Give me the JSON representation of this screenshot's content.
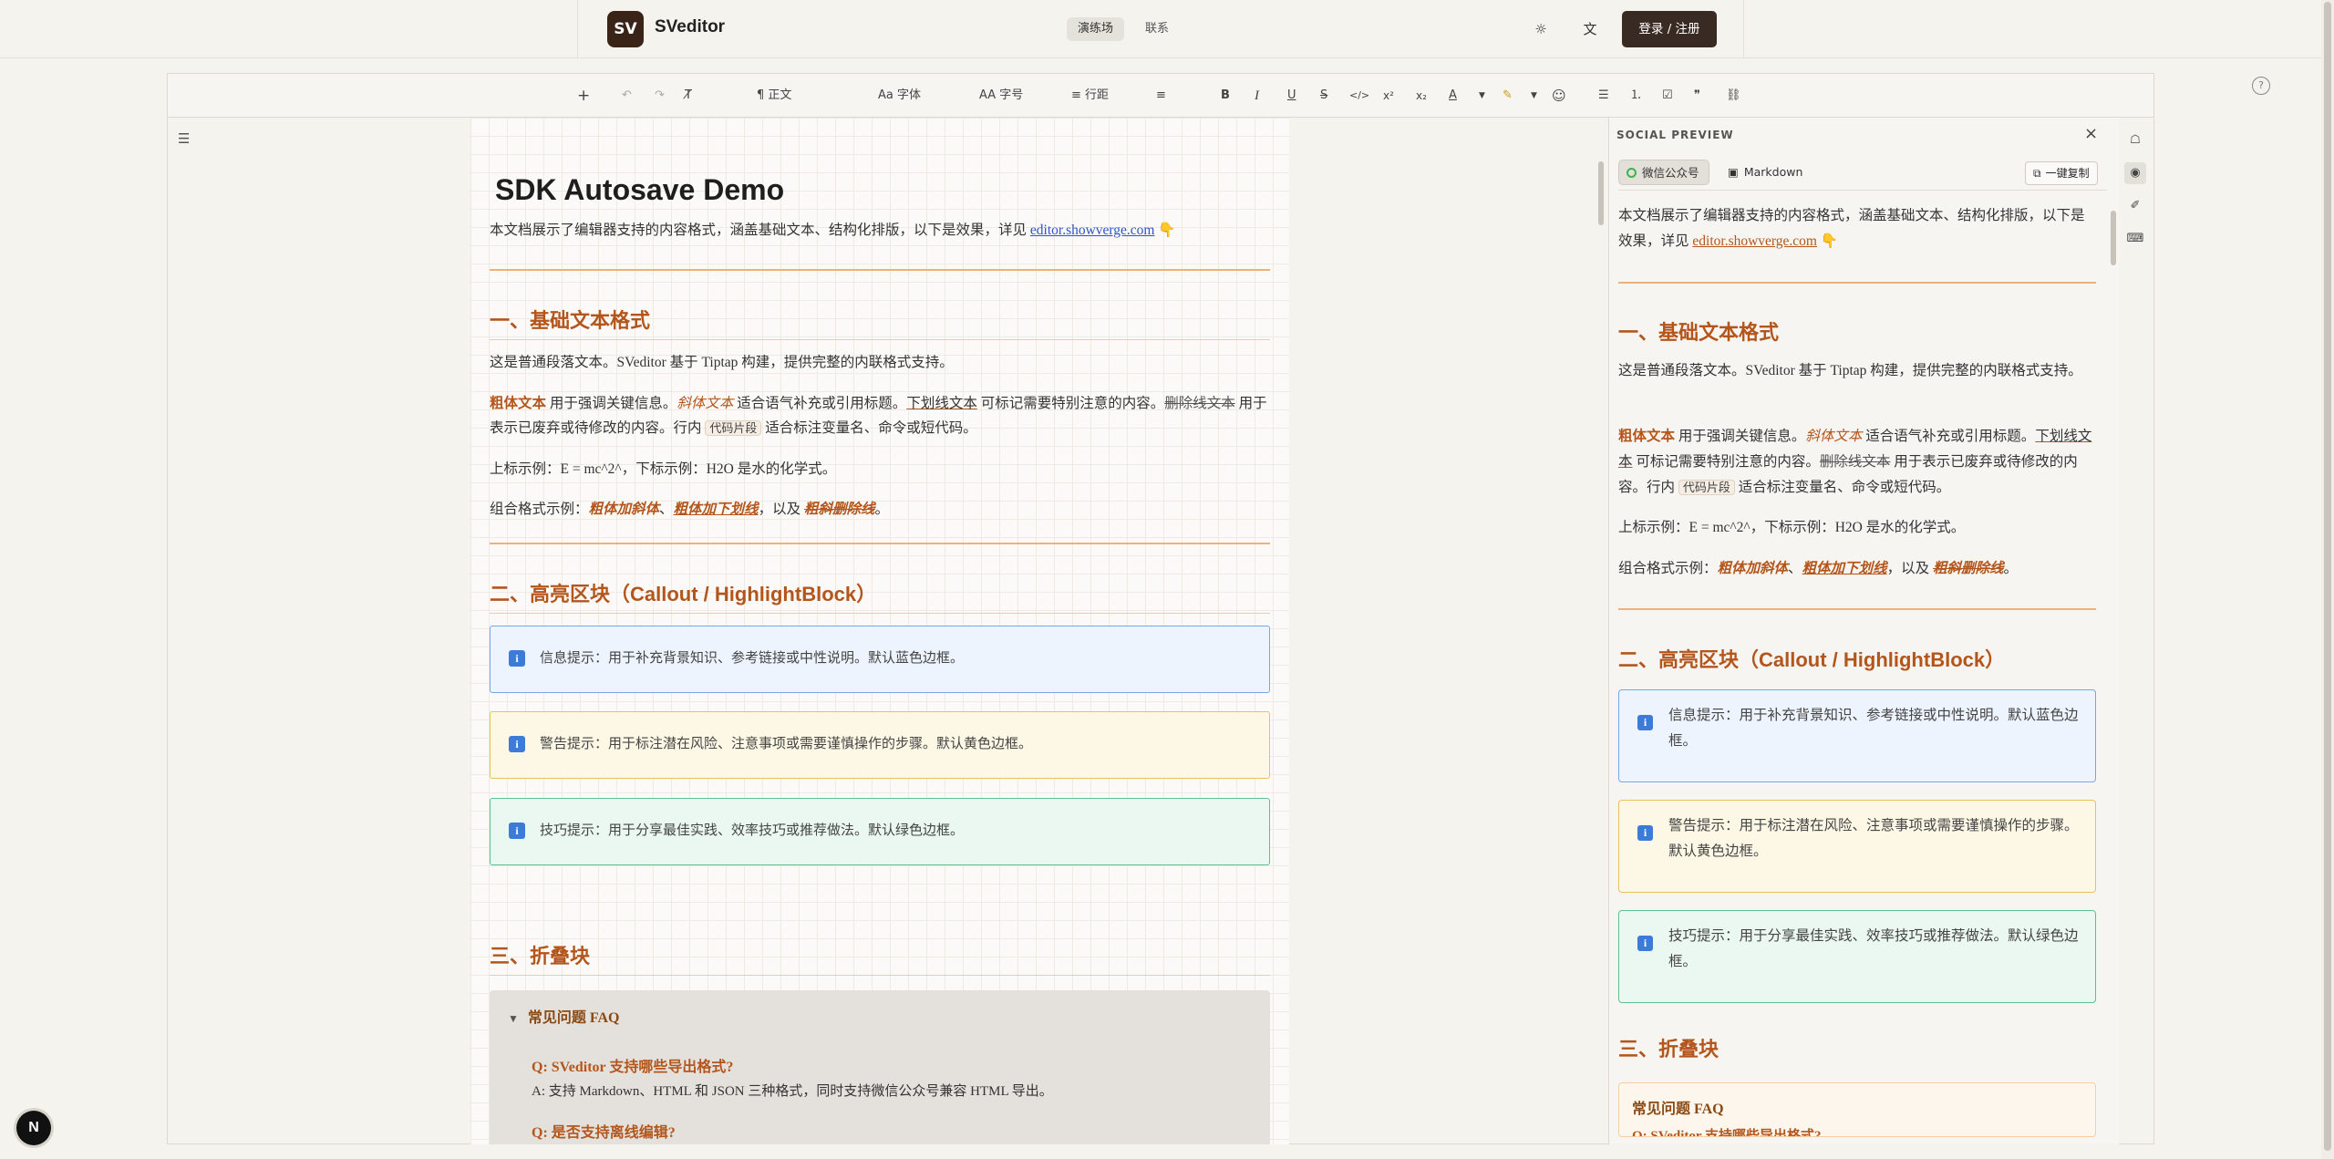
{
  "app": {
    "logo_text": "SV",
    "brand": "SVeditor",
    "nav": {
      "playground": "演练场",
      "contact": "联系"
    },
    "login_label": "登录 / 注册"
  },
  "toolbar": {
    "add": "+",
    "undo": "↶",
    "redo": "↷",
    "clear_format": "T̸",
    "paragraph": "¶ 正文",
    "font": "Aa 字体",
    "font_size": "AA 字号",
    "line_height": "≡ 行距",
    "align": "≡",
    "bold": "B",
    "italic": "I",
    "underline": "U",
    "strike": "S",
    "code": "</>",
    "superscript": "x²",
    "subscript": "x₂",
    "text_color": "A",
    "highlight": "✎",
    "emoji": "☺",
    "bullet_list": "☰",
    "ordered_list": "⒈",
    "task_list": "☑",
    "quote": "❞",
    "link": "⛓"
  },
  "doc": {
    "title": "SDK Autosave Demo",
    "intro_prefix": "本文档展示了编辑器支持的内容格式，涵盖基础文本、结构化排版，以下是效果，详见 ",
    "intro_link": "editor.showverge.com",
    "intro_emoji": "👇",
    "h_basic": "一、基础文本格式",
    "p_normal": "这是普通段落文本。SVeditor 基于 Tiptap 构建，提供完整的内联格式支持。",
    "fmt": {
      "bold": "粗体文本",
      "t1": " 用于强调关键信息。",
      "italic": "斜体文本",
      "t2": " 适合语气补充或引用标题。",
      "underline": "下划线文本",
      "t3": " 可标记需要特别注意的内容。",
      "strike": "删除线文本",
      "t4": " 用于表示已废弃或待修改的内容。行内 ",
      "code": "代码片段",
      "t5": " 适合标注变量名、命令或短代码。"
    },
    "p_sup": "上标示例：E = mc^2^，下标示例：H2O 是水的化学式。",
    "combo": {
      "prefix": "组合格式示例：",
      "bi": "粗体加斜体",
      "sep": "、",
      "biu": "粗体加下划线",
      "mid": "，以及 ",
      "bis": "粗斜删除线",
      "end": "。"
    },
    "h_callout": "二、高亮区块（Callout / HighlightBlock）",
    "callout_info": "信息提示：用于补充背景知识、参考链接或中性说明。默认蓝色边框。",
    "callout_warn": "警告提示：用于标注潜在风险、注意事项或需要谨慎操作的步骤。默认黄色边框。",
    "callout_tip": "技巧提示：用于分享最佳实践、效率技巧或推荐做法。默认绿色边框。",
    "h_collapse": "三、折叠块",
    "faq_title": "常见问题 FAQ",
    "faq_q1": "Q: SVeditor 支持哪些导出格式?",
    "faq_a1": "A: 支持 Markdown、HTML 和 JSON 三种格式，同时支持微信公众号兼容 HTML 导出。",
    "faq_q2": "Q: 是否支持离线编辑?"
  },
  "preview": {
    "title": "SOCIAL PREVIEW",
    "close": "×",
    "tab_wechat": "微信公众号",
    "tab_markdown": "Markdown",
    "copy_label": "一键复制",
    "faq_title": "常见问题 FAQ",
    "faq_q1_partial": "Q: SVeditor 支持哪些导出格式?"
  },
  "colors": {
    "accent": "#b4561c",
    "link": "#2e54c9",
    "info_border": "#78a5e8",
    "warn_border": "#e7c25a",
    "tip_border": "#5fc08f"
  },
  "badge": "N"
}
